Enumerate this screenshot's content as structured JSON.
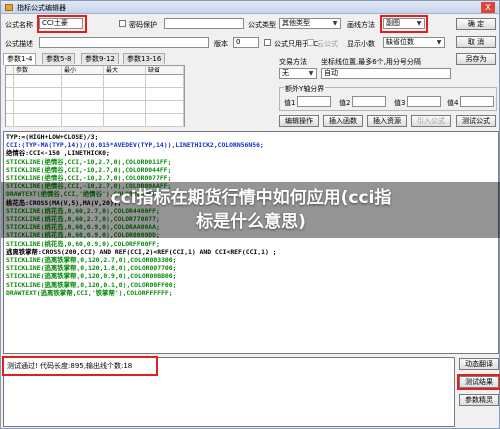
{
  "window": {
    "title": "指标公式编辑器",
    "close_label": "X"
  },
  "form": {
    "name_label": "公式名称",
    "name_value": "CCI土豪",
    "password_label": "密码保护",
    "type_label": "公式类型",
    "type_value": "其他类型",
    "draw_label": "画线方法",
    "draw_value": "副图",
    "ok_label": "确 定",
    "desc_label": "公式描述",
    "version_label": "版本",
    "version_value": "0",
    "pc_label": "公式只用于PC",
    "cloud_label": "云公式",
    "decimals_label": "显示小数",
    "decimals_value": "缺省位数",
    "cancel_label": "取 消",
    "saveas_label": "另存为"
  },
  "tabs": [
    "参数1-4",
    "参数5-8",
    "参数9-12",
    "参数13-16"
  ],
  "param_headers": [
    "参数",
    "最小",
    "最大",
    "缺省"
  ],
  "right_panel": {
    "trade_method_label": "交易方法",
    "axis_label": "坐标线位置,最多6个,用分号分隔",
    "trade_value": "无",
    "axis_value": "自动",
    "extra_group_label": "额外Y轴分界",
    "val1": "值1",
    "val2": "值2",
    "val3": "值3",
    "val4": "值4"
  },
  "toolbar": {
    "edit_ops": "编辑操作",
    "insert_func": "插入函数",
    "insert_res": "插入资源",
    "import_formula": "引入公式",
    "test_formula": "测试公式",
    "dynamic_translate": "动态翻译",
    "test_result": "测试结果",
    "param_wizard": "参数精灵"
  },
  "code_lines": [
    {
      "c": "blk",
      "t": "TYP:=(HIGH+LOW+CLOSE)/3;"
    },
    {
      "c": "blu",
      "t": "CCI:(TYP-MA(TYP,14))/(0.015*AVEDEV(TYP,14)),LINETHICK2,COLORN56N56;"
    },
    {
      "c": "blk",
      "t": "绝情谷:CCI<-150 ,LINETHICK0;"
    },
    {
      "c": "grn",
      "t": "STICKLINE(绝情谷,CCI,-10,2.7,0),COLOR0011FF;"
    },
    {
      "c": "grn",
      "t": "STICKLINE(绝情谷,CCI,-10,2.7,0),COLOR0044FF;"
    },
    {
      "c": "grn",
      "t": "STICKLINE(绝情谷,CCI,-10,2.7,0),COLOR0077FF;"
    },
    {
      "c": "grn",
      "t": "STICKLINE(绝情谷,CCI,-10,2.7,0),COLOR00AAFF;"
    },
    {
      "c": "grn",
      "t": "DRAWTEXT(绝情谷,CCI,'绝情谷'),COLOR0000FF;"
    },
    {
      "c": "blk",
      "t": "桃花岛:CROSS(MA(V,5),MA(V,20));"
    },
    {
      "c": "grn",
      "t": "STICKLINE(桃花岛,0,60,2.7,0),COLOR4400FF;"
    },
    {
      "c": "grn",
      "t": "STICKLINE(桃花岛,0,60,2.7,0),COLOR770077;"
    },
    {
      "c": "grn",
      "t": "STICKLINE(桃花岛,0,60,0.9,0),COLORAA00AA;"
    },
    {
      "c": "grn",
      "t": "STICKLINE(桃花岛,0,60,0.9,0),COLOR0000DD;"
    },
    {
      "c": "grn",
      "t": "STICKLINE(桃花岛,0,60,0.9,0),COLORFF00FF;"
    },
    {
      "c": "blk",
      "t": "逃离铁掌帮:CROSS(200,CCI) AND REF(CCI,2)<REF(CCI,1) AND CCI<REF(CCI,1) ;"
    },
    {
      "c": "grn",
      "t": "STICKLINE(逃离铁掌帮,0,120,2.7,0),COLOR003300;"
    },
    {
      "c": "grn",
      "t": "STICKLINE(逃离铁掌帮,0,120,1.8,0),COLOR007700;"
    },
    {
      "c": "grn",
      "t": "STICKLINE(逃离铁掌帮,0,120,0.9,0),COLOR00BB00;"
    },
    {
      "c": "grn",
      "t": "STICKLINE(逃离铁掌帮,0,120,0.1,0),COLOR00FF00;"
    },
    {
      "c": "grn",
      "t": "DRAWTEXT(逃离铁掌帮,CCI,'铁掌帮'),COLORFFFFFF;"
    }
  ],
  "status_text": "测试通过! 代码长度:895,输出线个数:18",
  "overlay": {
    "line1": "cci指标在期货行情中如何应用(cci指",
    "line2": "标是什么意思)"
  },
  "colors": {
    "highlight": "#e02020",
    "code_blue": "#1530c8",
    "code_green": "#0a8a0a"
  }
}
